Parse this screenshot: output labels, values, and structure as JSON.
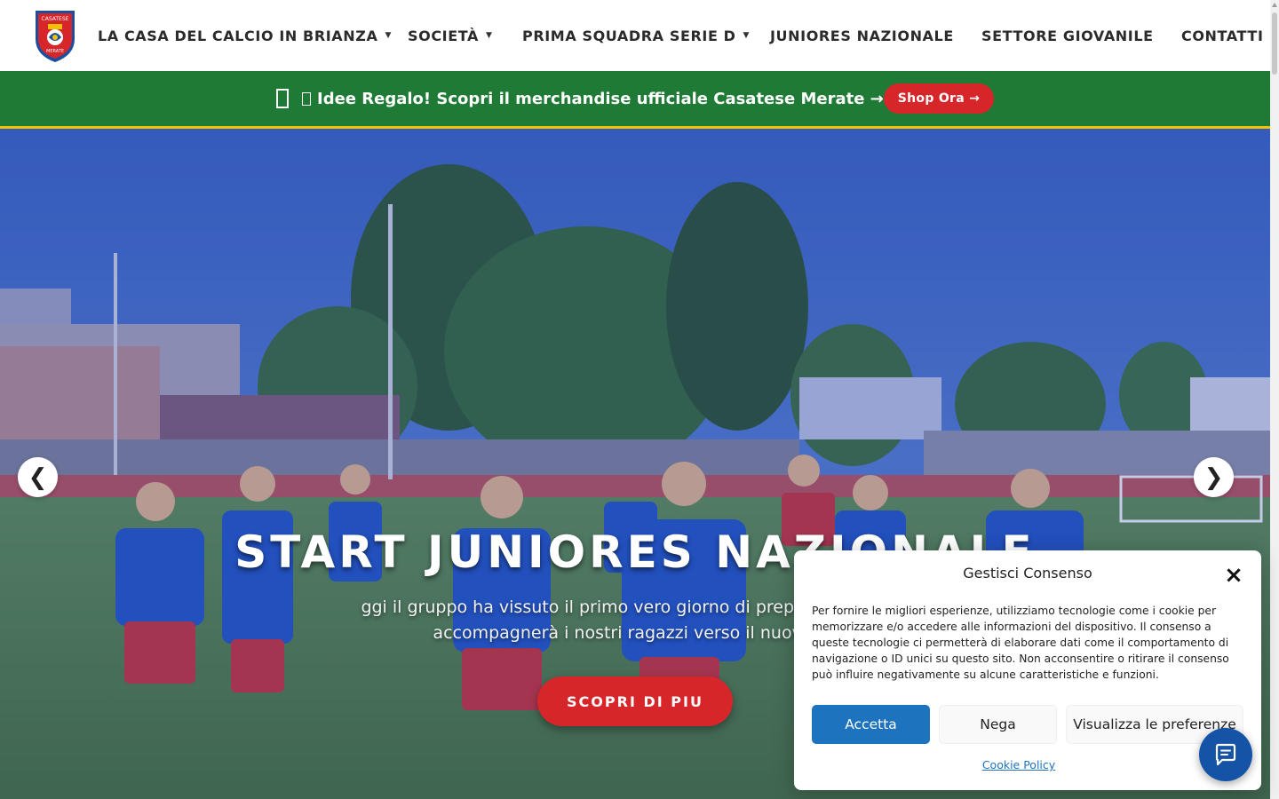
{
  "header": {
    "logo": {
      "top_text": "CASATESE",
      "bottom_text": "MERATE",
      "alt": "Casatese Merate logo"
    },
    "nav": [
      {
        "label": "LA CASA DEL CALCIO IN BRIANZA",
        "has_dropdown": true
      },
      {
        "label": "SOCIETÀ",
        "has_dropdown": true
      },
      {
        "label": "PRIMA SQUADRA SERIE D",
        "has_dropdown": true
      },
      {
        "label": "JUNIORES NAZIONALE",
        "has_dropdown": false
      },
      {
        "label": "SETTORE GIOVANILE",
        "has_dropdown": false
      },
      {
        "label": "CONTATTI",
        "has_dropdown": false
      }
    ],
    "dropdown_glyph": "▼"
  },
  "promo": {
    "text": "Idee Regalo! Scopri il merchandise ufficiale Casatese Merate →",
    "button": "Shop Ora →",
    "bg_color": "#1e7a34",
    "accent_color": "#f2c200"
  },
  "hero": {
    "title": "START JUNIORES NAZIONALE",
    "subtitle_line1": "ggi il gruppo ha vissuto il primo vero giorno di preparazione, dan",
    "subtitle_line2": "accompagnerà i nostri ragazzi verso il nuovo ca",
    "button": "SCOPRI DI PIU",
    "prev_arrow": "❮",
    "next_arrow": "❯"
  },
  "consent": {
    "title": "Gestisci Consenso",
    "close": "×",
    "body": "Per fornire le migliori esperienze, utilizziamo tecnologie come i cookie per memorizzare e/o accedere alle informazioni del dispositivo. Il consenso a queste tecnologie ci permetterà di elaborare dati come il comportamento di navigazione o ID unici su questo sito. Non acconsentire o ritirare il consenso può influire negativamente su alcune caratteristiche e funzioni.",
    "accept": "Accetta",
    "deny": "Nega",
    "preferences": "Visualizza le preferenze",
    "policy_link": "Cookie Policy"
  },
  "colors": {
    "brand_red": "#d6262a",
    "accept_blue": "#1e73be",
    "chat_blue": "#1553a6"
  },
  "icons": {
    "gift": "gift-icon",
    "close": "close-icon",
    "chat": "chat-icon",
    "dropdown": "chevron-down-icon"
  }
}
